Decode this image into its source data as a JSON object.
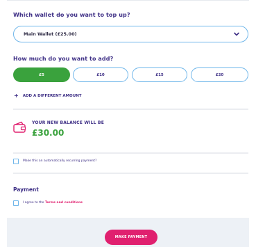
{
  "wallet_section": {
    "question": "Which wallet do you want to top up?",
    "selected_wallet": "Main Wallet (£25.00)"
  },
  "amount_section": {
    "question": "How much do you want to add?",
    "options": [
      {
        "label": "£5",
        "selected": true
      },
      {
        "label": "£10",
        "selected": false
      },
      {
        "label": "£15",
        "selected": false
      },
      {
        "label": "£20",
        "selected": false
      }
    ],
    "add_different_label": "ADD A DIFFERENT AMOUNT"
  },
  "balance": {
    "label": "YOUR NEW BALANCE WILL BE",
    "value": "£30.00"
  },
  "recurring": {
    "label": "Make this an automatically recurring payment?",
    "checked": false
  },
  "payment": {
    "title": "Payment",
    "terms_prefix": "I agree to the ",
    "terms_link": "Terms and conditions",
    "checked": false,
    "submit_label": "MAKE PAYMENT"
  },
  "colors": {
    "accent_purple": "#3d2e85",
    "primary_green": "#3aa23d",
    "cta_pink": "#e0206f",
    "border_blue": "#6fb6ea"
  },
  "icons": {
    "select_chevron": "chevron-down-icon",
    "add_amount": "plus-icon",
    "balance": "wallet-icon"
  }
}
